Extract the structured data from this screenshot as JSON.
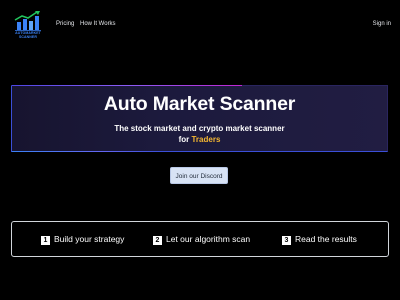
{
  "brand": {
    "logo_text": "AUTOMARKET SCANNER",
    "logo_icon": "bar-chart-logo-icon",
    "color_primary": "#3b82f6",
    "color_accent": "#f5b731"
  },
  "nav": {
    "pricing": "Pricing",
    "how_it_works": "How It Works",
    "sign_in": "Sign in"
  },
  "hero": {
    "title": "Auto Market Scanner",
    "subtitle_line1": "The stock market and crypto market scanner",
    "subtitle_for": "for ",
    "subtitle_highlight": "Traders"
  },
  "cta": {
    "discord_label": "Join our Discord"
  },
  "steps": [
    {
      "number": "1",
      "label": "Build your strategy"
    },
    {
      "number": "2",
      "label": "Let our algorithm scan"
    },
    {
      "number": "3",
      "label": "Read the results"
    }
  ]
}
